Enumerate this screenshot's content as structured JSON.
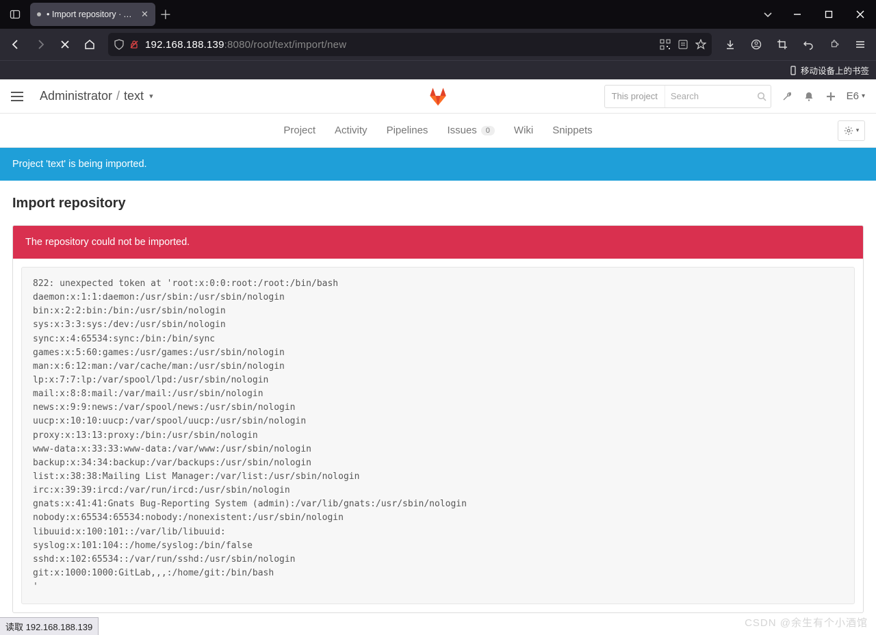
{
  "browser": {
    "tab_title": "• Import repository · Adr",
    "url_host": "192.168.188.139",
    "url_port": ":8080",
    "url_path": "/root/text/import/new",
    "bookmark_bar_label": "移动设备上的书签",
    "statusbar": "读取 192.168.188.139"
  },
  "gitlab": {
    "breadcrumb_user": "Administrator",
    "breadcrumb_sep": "/",
    "breadcrumb_project": "text",
    "search_scope": "This project",
    "search_placeholder": "Search",
    "user_label": "E6",
    "tabs": {
      "project": "Project",
      "activity": "Activity",
      "pipelines": "Pipelines",
      "issues": "Issues",
      "issues_count": "0",
      "wiki": "Wiki",
      "snippets": "Snippets"
    },
    "flash_info": "Project 'text' is being imported.",
    "page_title": "Import repository",
    "error_title": "The repository could not be imported.",
    "error_body": "822: unexpected token at 'root:x:0:0:root:/root:/bin/bash\ndaemon:x:1:1:daemon:/usr/sbin:/usr/sbin/nologin\nbin:x:2:2:bin:/bin:/usr/sbin/nologin\nsys:x:3:3:sys:/dev:/usr/sbin/nologin\nsync:x:4:65534:sync:/bin:/bin/sync\ngames:x:5:60:games:/usr/games:/usr/sbin/nologin\nman:x:6:12:man:/var/cache/man:/usr/sbin/nologin\nlp:x:7:7:lp:/var/spool/lpd:/usr/sbin/nologin\nmail:x:8:8:mail:/var/mail:/usr/sbin/nologin\nnews:x:9:9:news:/var/spool/news:/usr/sbin/nologin\nuucp:x:10:10:uucp:/var/spool/uucp:/usr/sbin/nologin\nproxy:x:13:13:proxy:/bin:/usr/sbin/nologin\nwww-data:x:33:33:www-data:/var/www:/usr/sbin/nologin\nbackup:x:34:34:backup:/var/backups:/usr/sbin/nologin\nlist:x:38:38:Mailing List Manager:/var/list:/usr/sbin/nologin\nirc:x:39:39:ircd:/var/run/ircd:/usr/sbin/nologin\ngnats:x:41:41:Gnats Bug-Reporting System (admin):/var/lib/gnats:/usr/sbin/nologin\nnobody:x:65534:65534:nobody:/nonexistent:/usr/sbin/nologin\nlibuuid:x:100:101::/var/lib/libuuid:\nsyslog:x:101:104::/home/syslog:/bin/false\nsshd:x:102:65534::/var/run/sshd:/usr/sbin/nologin\ngit:x:1000:1000:GitLab,,,:/home/git:/bin/bash\n'"
  },
  "watermark": "CSDN @余生有个小酒馆"
}
